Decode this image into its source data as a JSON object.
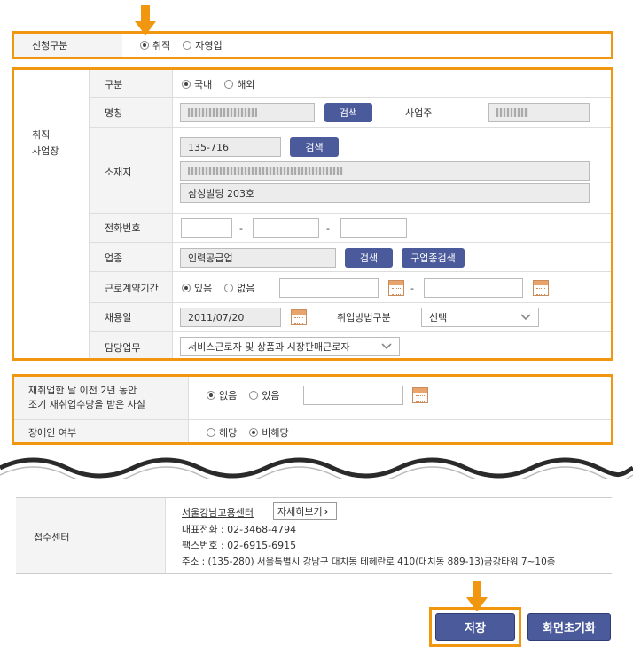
{
  "apply_type": {
    "label": "신청구분",
    "options": [
      {
        "label": "취직",
        "checked": true
      },
      {
        "label": "자영업",
        "checked": false
      }
    ]
  },
  "workplace": {
    "section_label_1": "취직",
    "section_label_2": "사업장",
    "category": {
      "label": "구분",
      "options": [
        {
          "label": "국내",
          "checked": true
        },
        {
          "label": "해외",
          "checked": false
        }
      ]
    },
    "name": {
      "label": "명칭",
      "search_label": "검색",
      "owner_label": "사업주"
    },
    "address": {
      "label": "소재지",
      "postal": "135-716",
      "search_label": "검색",
      "detail": "삼성빌딩 203호"
    },
    "phone": {
      "label": "전화번호",
      "dash": "-"
    },
    "industry": {
      "label": "업종",
      "value": "인력공급업",
      "search_label": "검색",
      "old_search_label": "구업종검색"
    },
    "contract_period": {
      "label": "근로계약기간",
      "options": [
        {
          "label": "있음",
          "checked": true
        },
        {
          "label": "없음",
          "checked": false
        }
      ],
      "dash": "-"
    },
    "hire_date": {
      "label": "채용일",
      "value": "2011/07/20",
      "method_label": "취업방법구분",
      "method_value": "선택"
    },
    "duty": {
      "label": "담당업무",
      "value": "서비스근로자 및 상품과 시장판매근로자"
    }
  },
  "extra": {
    "early_q_line1": "재취업한 날 이전 2년 동안",
    "early_q_line2": "조기 재취업수당을 받은 사실",
    "early_options": [
      {
        "label": "없음",
        "checked": true
      },
      {
        "label": "있음",
        "checked": false
      }
    ],
    "disability_label": "장애인 여부",
    "disability_options": [
      {
        "label": "해당",
        "checked": false
      },
      {
        "label": "비해당",
        "checked": true
      }
    ]
  },
  "center": {
    "label": "접수센터",
    "name": "서울강남고용센터",
    "detail_button": "자세히보기",
    "phone": "대표전화 : 02-3468-4794",
    "fax": "팩스번호 : 02-6915-6915",
    "address": "주소 : (135-280) 서울특별시 강남구 대치동 테헤란로 410(대치동 889-13)금강타워 7~10층"
  },
  "actions": {
    "save": "저장",
    "reset": "화면초기화"
  },
  "colors": {
    "highlight": "#f0960f",
    "button": "#4a5a9a"
  }
}
